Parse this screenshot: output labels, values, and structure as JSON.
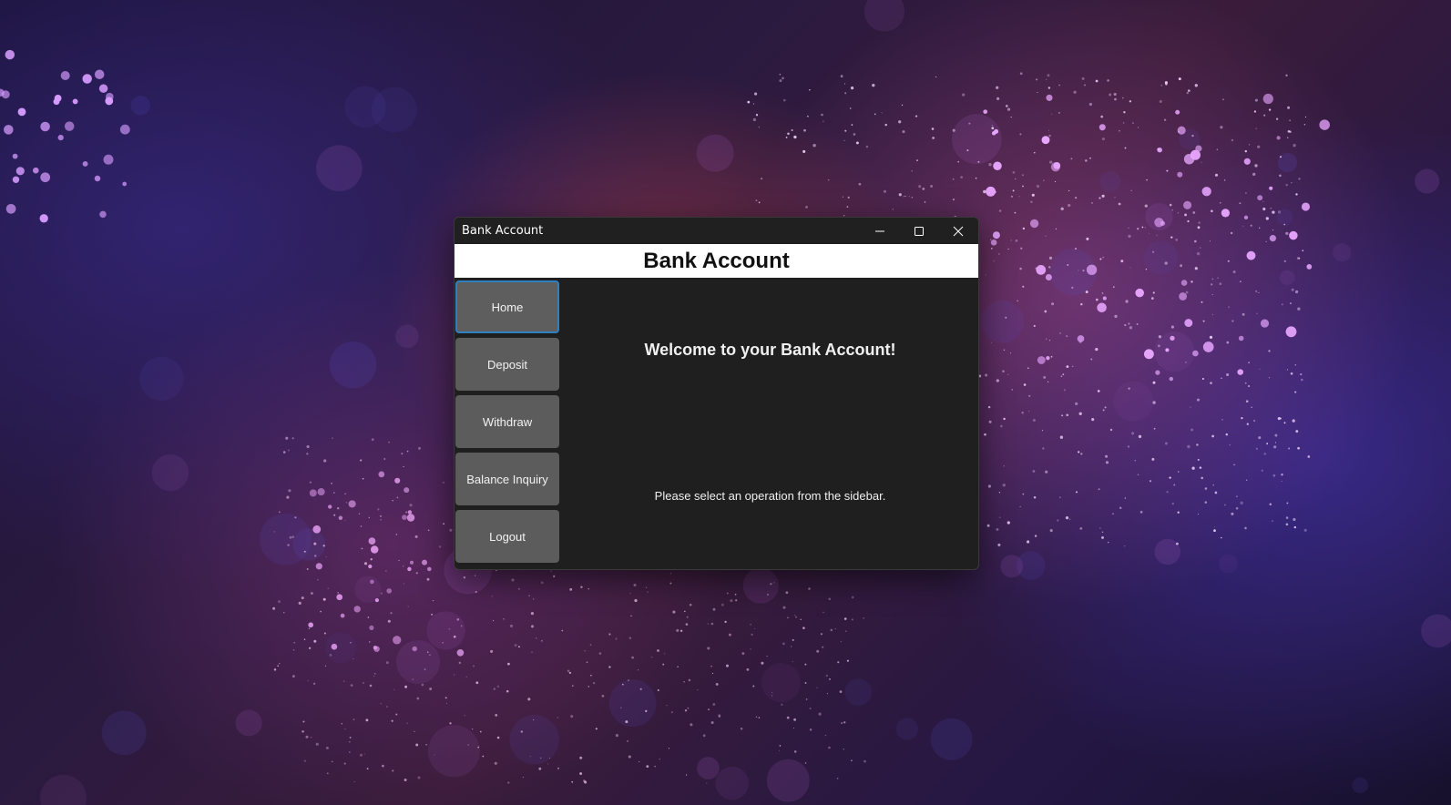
{
  "window": {
    "title": "Bank Account",
    "controls": {
      "minimize_icon": "minimize-icon",
      "maximize_icon": "maximize-icon",
      "close_icon": "close-icon"
    }
  },
  "header": {
    "title": "Bank Account"
  },
  "sidebar": {
    "items": [
      {
        "label": "Home",
        "active": true
      },
      {
        "label": "Deposit",
        "active": false
      },
      {
        "label": "Withdraw",
        "active": false
      },
      {
        "label": "Balance Inquiry",
        "active": false
      },
      {
        "label": "Logout",
        "active": false
      }
    ]
  },
  "main": {
    "welcome": "Welcome to your Bank Account!",
    "instruction": "Please select an operation from the sidebar."
  },
  "colors": {
    "window_bg": "#1f1f1f",
    "header_bg": "#ffffff",
    "button_bg": "#5c5c5c",
    "active_border": "#2f7fc1",
    "text_light": "#f0f0f0"
  }
}
